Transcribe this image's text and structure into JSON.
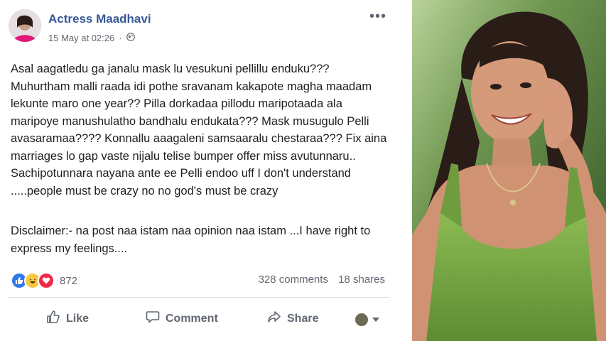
{
  "post": {
    "author": "Actress Maadhavi",
    "timestamp": "15 May at 02:26",
    "privacy_icon": "globe-icon",
    "more_icon": "•••",
    "body": "Asal aagatledu ga janalu mask lu vesukuni pellillu enduku??? Muhurtham malli raada idi pothe sravanam kakapote magha maadam lekunte maro one year?? Pilla dorkadaa pillodu maripotaada ala maripoye manushulatho bandhalu endukata??? Mask musugulo Pelli avasaramaa???? Konnallu aaagaleni samsaaralu chestaraa??? Fix aina marriages lo gap vaste nijalu telise bumper offer miss avutunnaru.. Sachipotunnara nayana ante ee Pelli endoo uff I don't understand .....people must be crazy no no god's must be crazy",
    "disclaimer": "Disclaimer:- na post naa istam naa opinion naa istam ...I have right to express my feelings...."
  },
  "engagement": {
    "reactions": [
      "like",
      "haha",
      "love"
    ],
    "reaction_count": "872",
    "comments": "328 comments",
    "shares": "18 shares"
  },
  "actions": {
    "like": "Like",
    "comment": "Comment",
    "share": "Share"
  },
  "colors": {
    "author": "#385898",
    "like_blue": "#2f78e7",
    "haha_yellow": "#f7c843",
    "love_red": "#f0294a",
    "photo_background": "#4f7a3a",
    "top_green": "#a8c78a"
  }
}
